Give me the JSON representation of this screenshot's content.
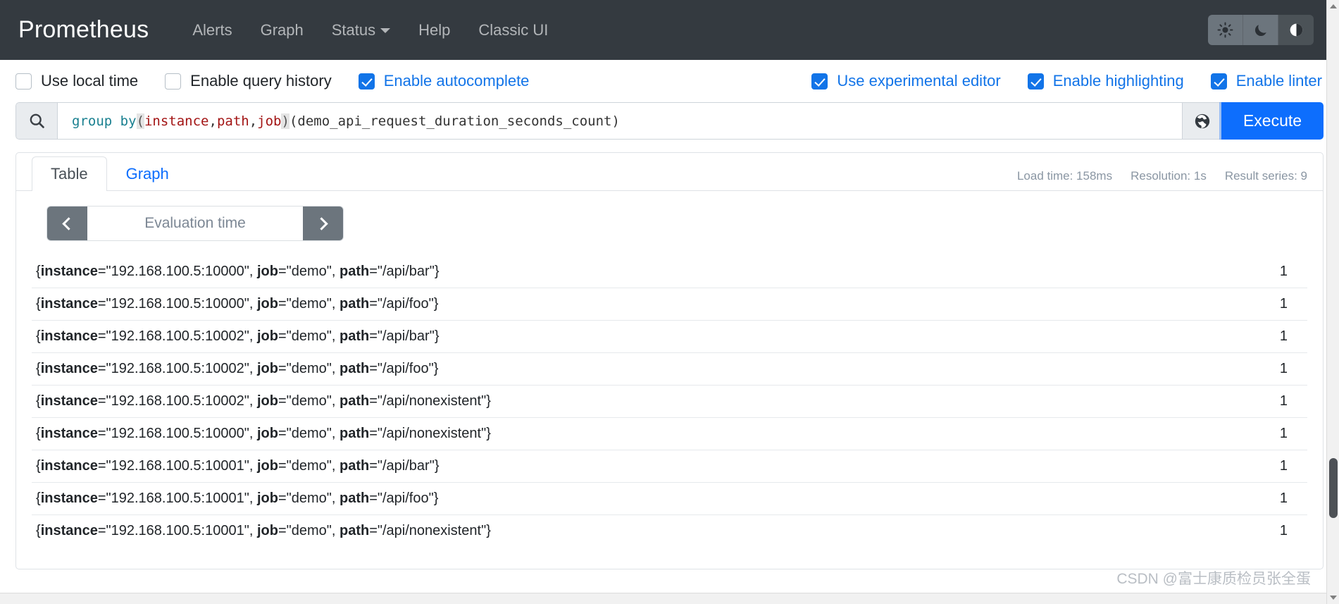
{
  "navbar": {
    "brand": "Prometheus",
    "links": [
      {
        "label": "Alerts",
        "has_caret": false
      },
      {
        "label": "Graph",
        "has_caret": false
      },
      {
        "label": "Status",
        "has_caret": true
      },
      {
        "label": "Help",
        "has_caret": false
      },
      {
        "label": "Classic UI",
        "has_caret": false
      }
    ],
    "theme": {
      "light_icon": "sun-icon",
      "dark_icon": "moon-icon",
      "auto_icon": "half-circle-icon",
      "selected": "auto"
    },
    "background": "#343a40"
  },
  "options": {
    "left": [
      {
        "label": "Use local time",
        "checked": false
      },
      {
        "label": "Enable query history",
        "checked": false
      },
      {
        "label": "Enable autocomplete",
        "checked": true
      }
    ],
    "right": [
      {
        "label": "Use experimental editor",
        "checked": true
      },
      {
        "label": "Enable highlighting",
        "checked": true
      },
      {
        "label": "Enable linter",
        "checked": true
      }
    ],
    "accent": "#1274e8"
  },
  "query": {
    "search_icon": "search-icon",
    "globe_icon": "globe-icon",
    "execute_label": "Execute",
    "execute_color": "#0d6efd",
    "expression": "group by(instance, path, job)(demo_api_request_duration_seconds_count)",
    "tokens": [
      {
        "text": "group by",
        "kind": "fn"
      },
      {
        "text": "(",
        "kind": "paren-hl"
      },
      {
        "text": "instance",
        "kind": "label"
      },
      {
        "text": ", ",
        "kind": "plain"
      },
      {
        "text": "path",
        "kind": "label"
      },
      {
        "text": ", ",
        "kind": "plain"
      },
      {
        "text": "job",
        "kind": "label"
      },
      {
        "text": ")",
        "kind": "paren-hl"
      },
      {
        "text": "(demo_api_request_duration_seconds_count)",
        "kind": "plain"
      }
    ]
  },
  "panel": {
    "tabs": [
      {
        "label": "Table",
        "active": true
      },
      {
        "label": "Graph",
        "active": false
      }
    ],
    "meta": [
      "Load time: 158ms",
      "Resolution: 1s",
      "Result series: 9"
    ],
    "evaluation_time": {
      "prev_icon": "chevron-left-icon",
      "next_icon": "chevron-right-icon",
      "placeholder": "Evaluation time",
      "value": ""
    },
    "results": [
      {
        "labels": [
          [
            "instance",
            "192.168.100.5:10000"
          ],
          [
            "job",
            "demo"
          ],
          [
            "path",
            "/api/bar"
          ]
        ],
        "value": "1"
      },
      {
        "labels": [
          [
            "instance",
            "192.168.100.5:10000"
          ],
          [
            "job",
            "demo"
          ],
          [
            "path",
            "/api/foo"
          ]
        ],
        "value": "1"
      },
      {
        "labels": [
          [
            "instance",
            "192.168.100.5:10002"
          ],
          [
            "job",
            "demo"
          ],
          [
            "path",
            "/api/bar"
          ]
        ],
        "value": "1"
      },
      {
        "labels": [
          [
            "instance",
            "192.168.100.5:10002"
          ],
          [
            "job",
            "demo"
          ],
          [
            "path",
            "/api/foo"
          ]
        ],
        "value": "1"
      },
      {
        "labels": [
          [
            "instance",
            "192.168.100.5:10002"
          ],
          [
            "job",
            "demo"
          ],
          [
            "path",
            "/api/nonexistent"
          ]
        ],
        "value": "1"
      },
      {
        "labels": [
          [
            "instance",
            "192.168.100.5:10000"
          ],
          [
            "job",
            "demo"
          ],
          [
            "path",
            "/api/nonexistent"
          ]
        ],
        "value": "1"
      },
      {
        "labels": [
          [
            "instance",
            "192.168.100.5:10001"
          ],
          [
            "job",
            "demo"
          ],
          [
            "path",
            "/api/bar"
          ]
        ],
        "value": "1"
      },
      {
        "labels": [
          [
            "instance",
            "192.168.100.5:10001"
          ],
          [
            "job",
            "demo"
          ],
          [
            "path",
            "/api/foo"
          ]
        ],
        "value": "1"
      },
      {
        "labels": [
          [
            "instance",
            "192.168.100.5:10001"
          ],
          [
            "job",
            "demo"
          ],
          [
            "path",
            "/api/nonexistent"
          ]
        ],
        "value": "1"
      }
    ]
  },
  "watermark": "CSDN @富士康质检员张全蛋"
}
